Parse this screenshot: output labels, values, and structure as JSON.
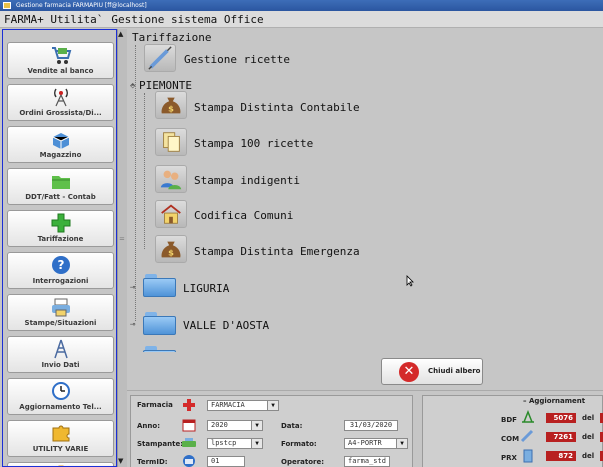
{
  "window": {
    "title": "Gestione farmacia FARMAPIU [ff@localhost]"
  },
  "menubar": {
    "app": "FARMA+ Utilita`",
    "section": "Gestione sistema Office"
  },
  "sidebar": {
    "items": [
      {
        "label": "Vendite al banco",
        "icon": "cart-icon"
      },
      {
        "label": "Ordini Grossista/Di...",
        "icon": "antenna-icon"
      },
      {
        "label": "Magazzino",
        "icon": "box-icon"
      },
      {
        "label": "DDT/Fatt - Contab",
        "icon": "folder-icon"
      },
      {
        "label": "Tariffazione",
        "icon": "green-cross-icon"
      },
      {
        "label": "Interrogazioni",
        "icon": "question-icon"
      },
      {
        "label": "Stampe/Situazioni",
        "icon": "printer-icon"
      },
      {
        "label": "Invio Dati",
        "icon": "tower-icon"
      },
      {
        "label": "Aggiornamento Tel...",
        "icon": "clock-icon"
      },
      {
        "label": "UTILITY VARIE",
        "icon": "puzzle-icon"
      }
    ]
  },
  "tree": {
    "root": "Tariffazione",
    "gestione_ricette": "Gestione ricette",
    "piemonte": "PIEMONTE",
    "piemonte_items": [
      {
        "label": "Stampa Distinta Contabile",
        "icon": "money-bag-icon"
      },
      {
        "label": "Stampa 100 ricette",
        "icon": "documents-icon"
      },
      {
        "label": "Stampa indigenti",
        "icon": "people-icon"
      },
      {
        "label": "Codifica Comuni",
        "icon": "house-icon"
      },
      {
        "label": "Stampa Distinta Emergenza",
        "icon": "money-bag-icon"
      }
    ],
    "liguria": "LIGURIA",
    "valle_aosta": "VALLE D'AOSTA"
  },
  "chiudi_albero": "Chiudi albero",
  "form": {
    "farmacia_label": "Farmacia",
    "farmacia_value": "FARMACIA",
    "anno_label": "Anno:",
    "anno_value": "2020",
    "data_label": "Data:",
    "data_value": "31/03/2020",
    "stampante_label": "Stampante:",
    "stampante_value": "lpstcp",
    "formato_label": "Formato:",
    "formato_value": "A4-PORTR",
    "termid_label": "TermID:",
    "termid_value": "01",
    "operatore_label": "Operatore:",
    "operatore_value": "farma_std"
  },
  "aggiornamenti": {
    "title": "Aggiornament",
    "rows": [
      {
        "code": "BDF",
        "value": "5076",
        "suffix": "del"
      },
      {
        "code": "COM",
        "value": "7261",
        "suffix": "del"
      },
      {
        "code": "PRX",
        "value": "872",
        "suffix": "del"
      }
    ]
  },
  "colors": {
    "accent_blue": "#1c2fd6",
    "badge_red": "#b82020",
    "close_red": "#d42a2a"
  }
}
